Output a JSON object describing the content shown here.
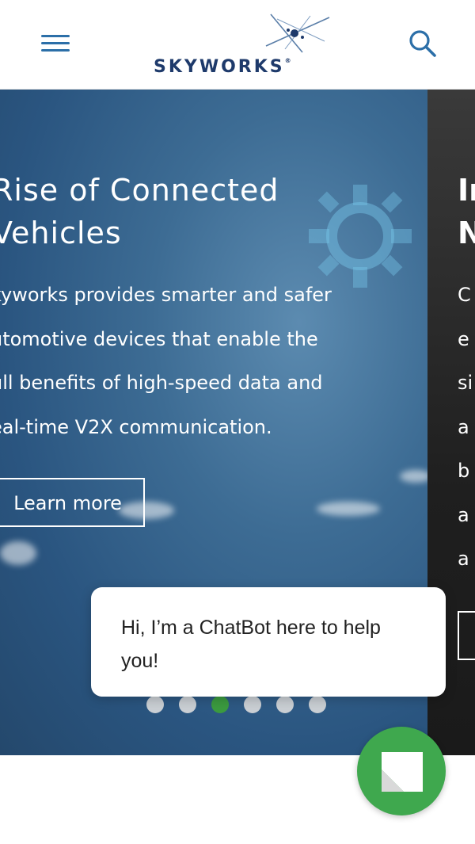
{
  "header": {
    "logo_text": "SKYWORKS",
    "logo_mark": "®",
    "menu_icon": "hamburger-menu-icon",
    "search_icon": "search-icon",
    "brand_color": "#2c6fa8"
  },
  "carousel": {
    "current_slide": {
      "title": "Rise of Connected\nVehicles",
      "body": "kyworks provides smarter and safer\nutomotive devices that enable the\null benefits of high-speed data and\neal-time V2X communication.",
      "button_label": "Learn more"
    },
    "next_slide_partial": {
      "title": "Ir\nN",
      "body": "C\ne\nsi\na\nb\na\na"
    },
    "dots": [
      {
        "active": false
      },
      {
        "active": false
      },
      {
        "active": true
      },
      {
        "active": false
      },
      {
        "active": false
      },
      {
        "active": false
      }
    ],
    "active_dot_color": "#3b9a3f"
  },
  "chatbot": {
    "message": "Hi, I’m a ChatBot here to help\nyou!",
    "launcher_color": "#3fa84e",
    "launcher_icon": "chat-bubble-icon"
  }
}
